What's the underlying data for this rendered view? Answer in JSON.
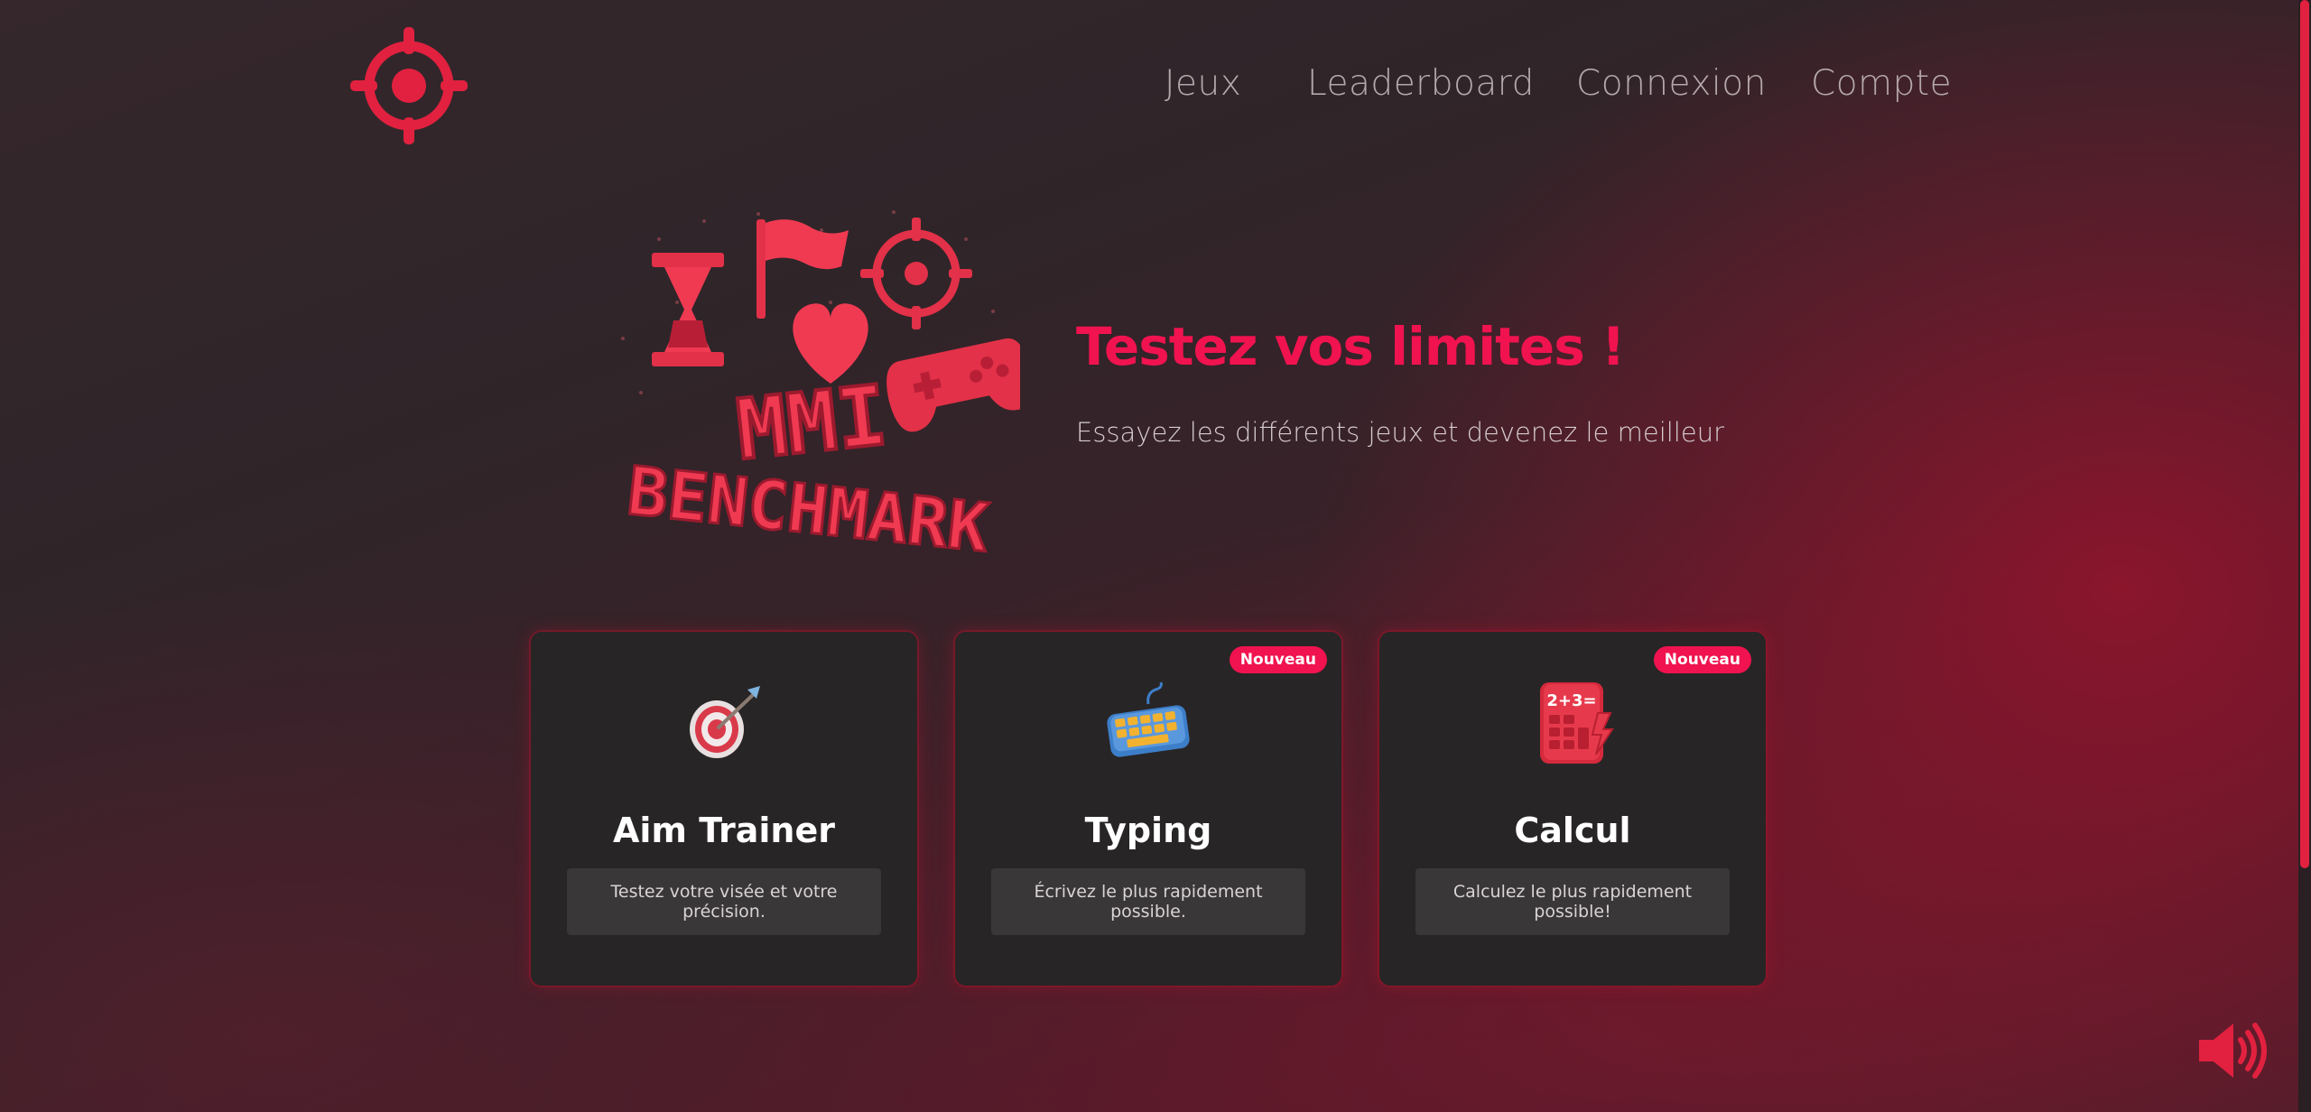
{
  "nav": {
    "items": [
      {
        "label": "Jeux"
      },
      {
        "label": "Leaderboard"
      },
      {
        "label": "Connexion"
      },
      {
        "label": "Compte"
      }
    ]
  },
  "hero": {
    "logo_text_line1": "MMI",
    "logo_text_line2": "BENCHMARK",
    "title": "Testez vos limites !",
    "subtitle": "Essayez les différents jeux et devenez le meilleur"
  },
  "games": [
    {
      "title": "Aim Trainer",
      "description": "Testez votre visée et votre précision.",
      "badge": "",
      "icon": "target-dart-icon"
    },
    {
      "title": "Typing",
      "description": "Écrivez le plus rapidement possible.",
      "badge": "Nouveau",
      "icon": "keyboard-icon"
    },
    {
      "title": "Calcul",
      "description": "Calculez le plus rapidement possible!",
      "badge": "Nouveau",
      "icon": "calculator-icon",
      "icon_text": "2+3="
    }
  ],
  "colors": {
    "accent": "#f0134f",
    "brand_red": "#e1213f",
    "card_bg": "#282526"
  },
  "icons": {
    "logo": "crosshair-icon",
    "sound": "speaker-icon"
  }
}
